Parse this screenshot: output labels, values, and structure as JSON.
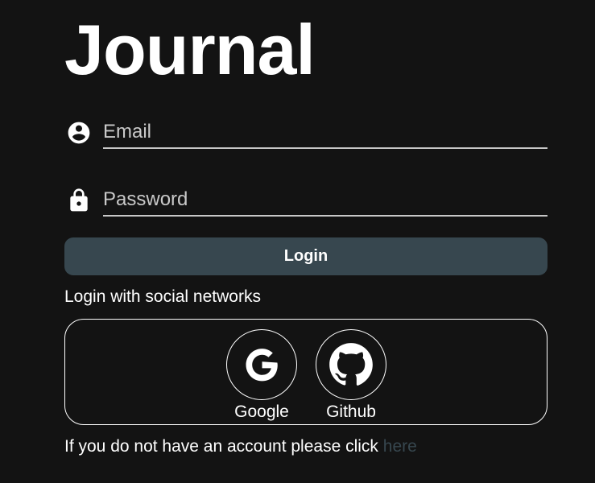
{
  "app": {
    "title": "Journal"
  },
  "form": {
    "email": {
      "placeholder": "Email",
      "value": "",
      "icon": "account-circle-icon"
    },
    "password": {
      "placeholder": "Password",
      "value": "",
      "icon": "lock-icon"
    },
    "login_label": "Login"
  },
  "social": {
    "heading": "Login with social networks",
    "providers": [
      {
        "label": "Google",
        "icon": "google-icon"
      },
      {
        "label": "Github",
        "icon": "github-icon"
      }
    ]
  },
  "register": {
    "text": "If you do not have an account please click",
    "link_text": "here"
  },
  "colors": {
    "background": "#131313",
    "text": "#ffffff",
    "accent": "#37474f",
    "input_underline": "#c7c7c7"
  }
}
